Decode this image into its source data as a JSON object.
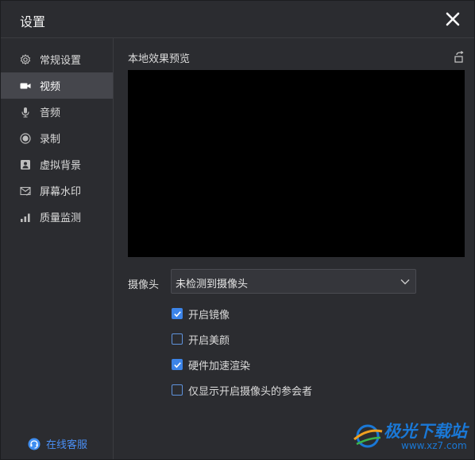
{
  "window": {
    "title": "设置"
  },
  "sidebar": {
    "items": [
      {
        "label": "常规设置",
        "icon": "gear-icon"
      },
      {
        "label": "视频",
        "icon": "video-camera-icon",
        "active": true
      },
      {
        "label": "音频",
        "icon": "microphone-icon"
      },
      {
        "label": "录制",
        "icon": "record-icon"
      },
      {
        "label": "虚拟背景",
        "icon": "virtual-background-icon"
      },
      {
        "label": "屏幕水印",
        "icon": "watermark-envelope-icon"
      },
      {
        "label": "质量监测",
        "icon": "signal-bars-icon"
      }
    ],
    "service": {
      "label": "在线客服",
      "icon": "customer-service-icon"
    }
  },
  "main": {
    "preview_title": "本地效果预览",
    "camera": {
      "label": "摄像头",
      "selected": "未检测到摄像头"
    },
    "options": [
      {
        "label": "开启镜像",
        "checked": true
      },
      {
        "label": "开启美颜",
        "checked": false
      },
      {
        "label": "硬件加速渲染",
        "checked": true
      },
      {
        "label": "仅显示开启摄像头的参会者",
        "checked": false
      }
    ]
  },
  "watermark": {
    "title": "极光下载站",
    "url": "www.xz7.com"
  },
  "colors": {
    "background": "#2b2c30",
    "active_item": "#45464c",
    "accent": "#3c84e8",
    "link": "#4a8ff5",
    "preview": "#000000"
  }
}
